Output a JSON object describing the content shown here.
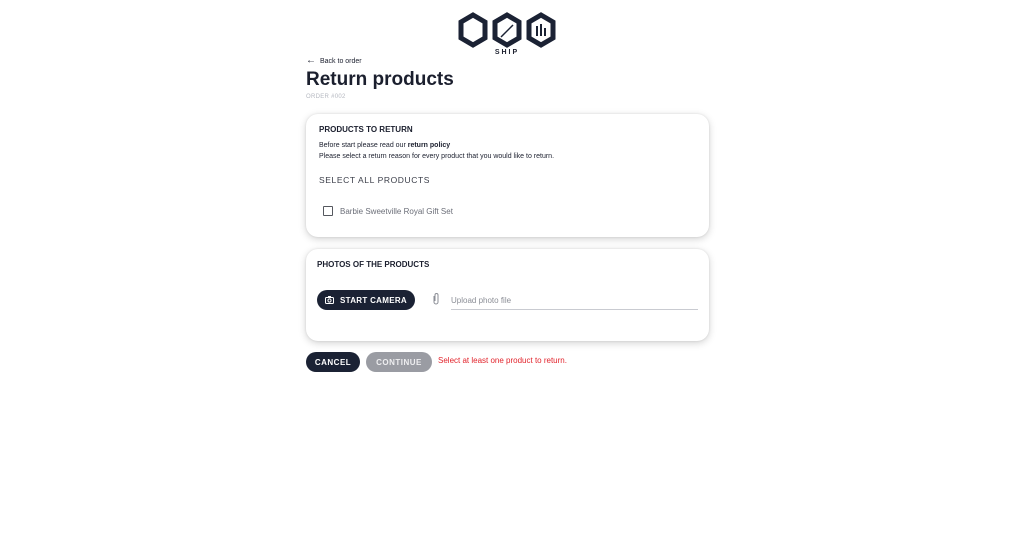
{
  "brand": {
    "name": "SHIP",
    "logo_icon": "ogo-hexagon-logo"
  },
  "nav": {
    "back_label": "Back to order",
    "back_icon": "arrow-left-icon"
  },
  "page": {
    "title": "Return products",
    "order_label": "ORDER #002"
  },
  "products_section": {
    "title": "PRODUCTS TO RETURN",
    "policy_prefix": "Before start please read our ",
    "policy_link": "return policy",
    "instruction": "Please select a return reason for every product that you would like to return.",
    "select_all_label": "SELECT ALL PRODUCTS",
    "items": [
      {
        "name": "Barbie Sweetville Royal Gift Set",
        "checked": false
      }
    ]
  },
  "photos_section": {
    "title": "PHOTOS OF THE PRODUCTS",
    "camera_button_label": "START CAMERA",
    "camera_icon": "camera-icon",
    "attach_icon": "paperclip-icon",
    "upload_placeholder": "Upload photo file"
  },
  "actions": {
    "cancel_label": "CANCEL",
    "continue_label": "CONTINUE",
    "error_message": "Select at least one product to return."
  },
  "colors": {
    "primary": "#1b2234",
    "disabled": "#9a9ca3",
    "error": "#e2232b",
    "text": "#1b1f2e"
  }
}
